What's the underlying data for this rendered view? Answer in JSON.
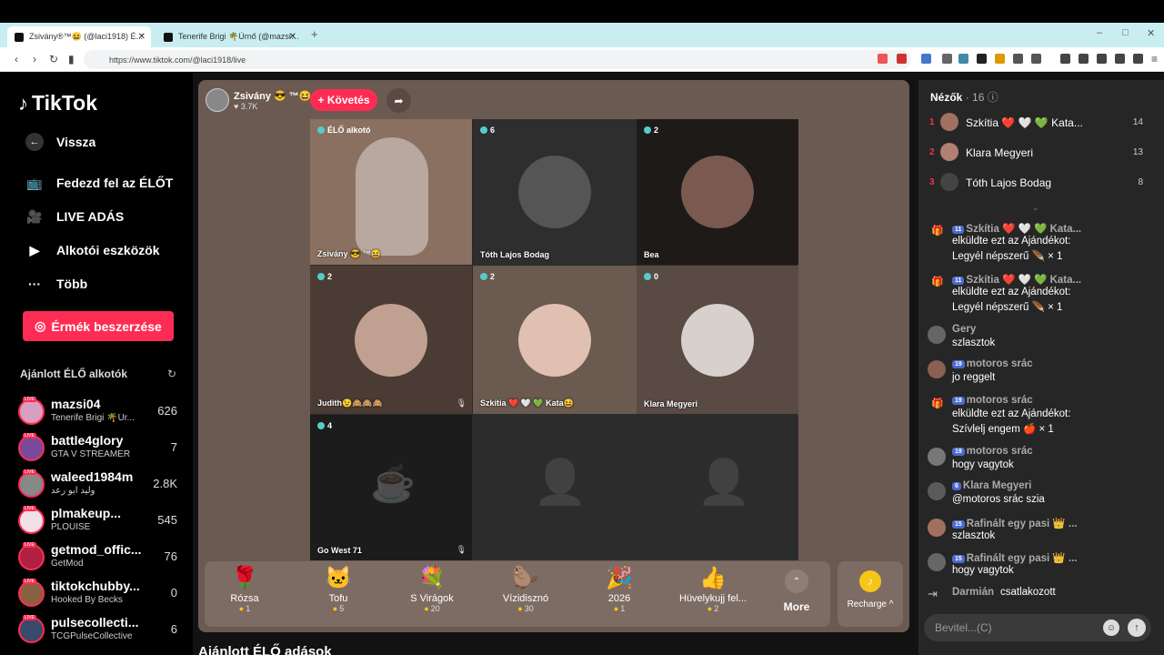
{
  "browser": {
    "tabs": [
      {
        "title": "Zsivány®™😆 (@laci1918) É...",
        "active": true
      },
      {
        "title": "Tenerife Brigi 🌴Úrnő (@mazsi04) É...",
        "active": false
      }
    ],
    "new_tab": "+",
    "url": "https://www.tiktok.com/@laci1918/live",
    "win_min": "–",
    "win_max": "□",
    "win_close": "✕"
  },
  "sidebar": {
    "brand": "TikTok",
    "back": "Vissza",
    "nav": [
      {
        "label": "Fedezd fel az ÉLŐT",
        "icon": "tv-icon"
      },
      {
        "label": "LIVE ADÁS",
        "icon": "camera-icon"
      },
      {
        "label": "Alkotói eszközök",
        "icon": "creator-tools-icon"
      },
      {
        "label": "Több",
        "icon": "more-icon"
      }
    ],
    "coins_button": "Érmék beszerzése",
    "suggested_title": "Ajánlott ÉLŐ alkotók",
    "live_badge": "LIVE",
    "suggested": [
      {
        "name": "mazsi04",
        "sub": "Tenerife Brigi 🌴Úr...",
        "count": "626",
        "color": "#d8a0c0"
      },
      {
        "name": "battle4glory",
        "sub": "GTA V STREAMER",
        "count": "7",
        "color": "#7a4a9a"
      },
      {
        "name": "waleed1984m",
        "sub": "وليد ابو رعد",
        "count": "2.8K",
        "color": "#888"
      },
      {
        "name": "plmakeup...",
        "sub": "PLOUISE",
        "count": "545",
        "color": "#f0e0e8"
      },
      {
        "name": "getmod_offic...",
        "sub": "GetMod",
        "count": "76",
        "color": "#b02040"
      },
      {
        "name": "tiktokchubby...",
        "sub": "Hooked By Becks",
        "count": "0",
        "color": "#8a6040"
      },
      {
        "name": "pulsecollecti...",
        "sub": "TCGPulseCollective",
        "count": "6",
        "color": "#3a4a6a"
      }
    ]
  },
  "live": {
    "host_name": "Zsivány 😎 ™😆",
    "host_likes": "♥ 3.7K",
    "follow": "+ Követés",
    "cells": [
      {
        "label": "Zsivány 😎 ™😆",
        "count": "ÉLŐ alkotó",
        "bg": "#8a7060"
      },
      {
        "label": "Tóth Lajos Bodag",
        "count": "6",
        "bg": "#2e2e2e"
      },
      {
        "label": "Bea",
        "count": "2",
        "bg": "#1e1a18"
      },
      {
        "label": "Judith😉🙈🙈🙈",
        "count": "2",
        "bg": "#4a3c34"
      },
      {
        "label": "Szkítia ❤️ 🤍 💚 Kata😆",
        "count": "2",
        "bg": "#6a5a50"
      },
      {
        "label": "Klara Megyeri",
        "count": "0",
        "bg": "#5a4a44"
      },
      {
        "label": "Go West 71",
        "count": "4",
        "bg": "#1c1c1c"
      },
      {
        "label": "",
        "count": "",
        "bg": "#2c2c2c"
      },
      {
        "label": "",
        "count": "",
        "bg": "#2c2c2c"
      }
    ],
    "gifts": [
      {
        "name": "Rózsa",
        "price": "1",
        "icon": "🌹"
      },
      {
        "name": "Tofu",
        "price": "5",
        "icon": "🐱"
      },
      {
        "name": "S Virágok",
        "price": "20",
        "icon": "💐"
      },
      {
        "name": "Vízidisznó",
        "price": "30",
        "icon": "🦫"
      },
      {
        "name": "2026",
        "price": "1",
        "icon": "🎉"
      },
      {
        "name": "Hüvelykujj fel...",
        "price": "2",
        "icon": "👍"
      }
    ],
    "more": "More",
    "recharge": "Recharge ^",
    "bottom_title": "Ajánlott ÉLŐ adások"
  },
  "chat": {
    "viewers_title": "Nézők",
    "viewers_count": "· 16 ⓘ",
    "ranking": [
      {
        "rank": "1",
        "name": "Szkítia ❤️ 🤍 💚 Kata...",
        "score": "14",
        "color": "#a07060"
      },
      {
        "rank": "2",
        "name": "Klara Megyeri",
        "score": "13",
        "color": "#b08070"
      },
      {
        "rank": "3",
        "name": "Tóth Lajos Bodag",
        "score": "8",
        "color": "#444"
      }
    ],
    "messages": [
      {
        "who": "Szkítia ❤️ 🤍 💚 Kata...",
        "lvl": "11",
        "lines": [
          "elküldte ezt az Ajándékot:",
          " Legyél népszerű 🪶 × 1"
        ],
        "gift": true
      },
      {
        "who": "Szkítia ❤️ 🤍 💚 Kata...",
        "lvl": "11",
        "lines": [
          "elküldte ezt az Ajándékot:",
          " Legyél népszerű 🪶 × 1"
        ],
        "gift": true
      },
      {
        "who": "Gery",
        "lvl": "",
        "lines": [
          "szlasztok"
        ],
        "gift": false
      },
      {
        "who": "motoros srác",
        "lvl": "19",
        "lines": [
          "jo reggelt"
        ],
        "gift": false
      },
      {
        "who": "motoros srác",
        "lvl": "19",
        "lines": [
          "elküldte ezt az Ajándékot:",
          " Szívlelj engem 🍎 × 1"
        ],
        "gift": true
      },
      {
        "who": "motoros srác",
        "lvl": "19",
        "lines": [
          "hogy vagytok"
        ],
        "gift": false
      },
      {
        "who": "Klara Megyeri",
        "lvl": "6",
        "lines": [
          "@motoros srác szia"
        ],
        "gift": false
      },
      {
        "who": "Rafinált egy pasi 👑 ...",
        "lvl": "15",
        "lines": [
          "szlasztok"
        ],
        "gift": false
      },
      {
        "who": "Rafinált egy pasi 👑 ...",
        "lvl": "15",
        "lines": [
          "hogy vagytok"
        ],
        "gift": false
      }
    ],
    "join_name": "Darmián",
    "join_text": "csatlakozott",
    "input_placeholder": "Bevitel...(C)"
  }
}
